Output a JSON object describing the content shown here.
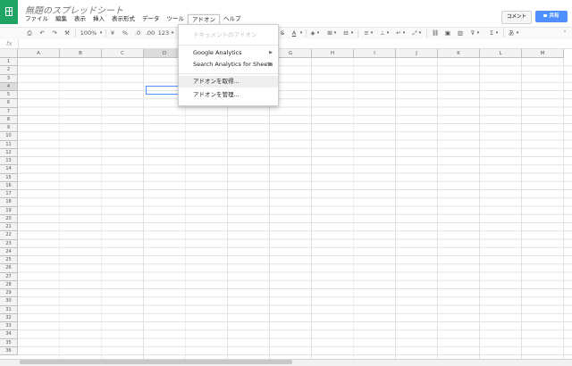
{
  "header": {
    "doc_title": "無題のスプレッドシート",
    "comment_label": "コメント",
    "share_label": "共有"
  },
  "menubar": {
    "items": [
      "ファイル",
      "編集",
      "表示",
      "挿入",
      "表示形式",
      "データ",
      "ツール",
      "アドオン",
      "ヘルプ"
    ]
  },
  "toolbar": {
    "zoom": "100%",
    "currency": "¥",
    "percent": "%",
    "decimal_less": ".0",
    "decimal_more": ".00",
    "format_more": "123",
    "bold": "B",
    "text_color": "A",
    "functions": "Σ",
    "input_tools": "あ"
  },
  "formula_bar": {
    "fx": "fx",
    "value": ""
  },
  "grid": {
    "columns": [
      "A",
      "B",
      "C",
      "D",
      "E",
      "F",
      "G",
      "H",
      "I",
      "J",
      "K",
      "L",
      "M"
    ],
    "rows": [
      "1",
      "2",
      "3",
      "4",
      "5",
      "6",
      "7",
      "8",
      "9",
      "10",
      "11",
      "12",
      "13",
      "14",
      "15",
      "16",
      "17",
      "18",
      "19",
      "20",
      "21",
      "22",
      "23",
      "24",
      "25",
      "26",
      "27",
      "28",
      "29",
      "30",
      "31",
      "32",
      "33",
      "34",
      "35",
      "36"
    ],
    "selected_column": "D",
    "selected_row": "4"
  },
  "addon_menu": {
    "doc_addons": "ドキュメントのアドオン",
    "google_analytics": "Google Analytics",
    "search_analytics": "Search Analytics for Sheets",
    "get_addons": "アドオンを取得...",
    "manage_addons": "アドオンを管理..."
  },
  "colors": {
    "brand": "#1fa463",
    "accent": "#4d90fe"
  }
}
